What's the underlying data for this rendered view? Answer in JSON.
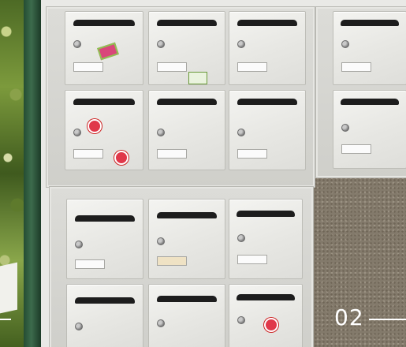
{
  "caption": {
    "number": "02"
  },
  "colors": {
    "cabinet": "#d6d6d2",
    "door": "#eeeeeb",
    "slot": "#1d1d1d",
    "post": "#2e5a3d",
    "wall": "#837a6b",
    "caption_text": "#ffffff"
  },
  "icons": [
    "lock-icon",
    "sticker-icon"
  ]
}
